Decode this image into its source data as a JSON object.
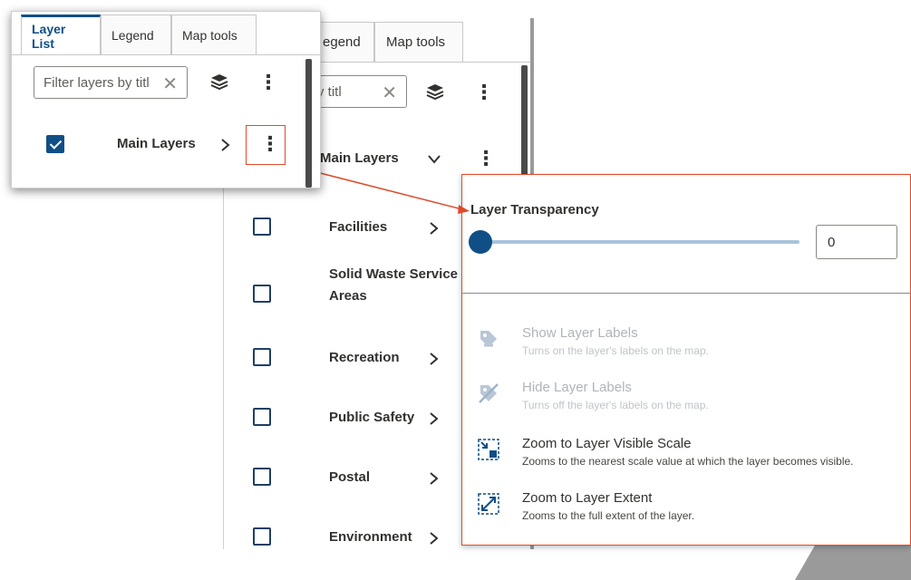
{
  "background_panel": {
    "tabs": [
      {
        "label": "egend"
      },
      {
        "label": "Map tools"
      }
    ],
    "filter_visible_text": "y titl",
    "rows": [
      {
        "label": "Main Layers",
        "checked": false,
        "expand": "chevron-down"
      },
      {
        "label": "Facilities",
        "checked": false,
        "expand": "chevron-right"
      },
      {
        "label_line1": "Solid Waste Service",
        "label_line2": "Areas",
        "checked": false
      },
      {
        "label": "Recreation",
        "checked": false,
        "expand": "chevron-right"
      },
      {
        "label": "Public Safety",
        "checked": false,
        "expand": "chevron-right"
      },
      {
        "label": "Postal",
        "checked": false,
        "expand": "chevron-right"
      },
      {
        "label": "Environment",
        "checked": false,
        "expand": "chevron-right"
      }
    ]
  },
  "popup": {
    "transparency_label": "Layer Transparency",
    "transparency_value": "0",
    "items": [
      {
        "label": "Show Layer Labels",
        "desc": "Turns on the layer's labels on the map.",
        "enabled": false,
        "icon": "tag-icon"
      },
      {
        "label": "Hide Layer Labels",
        "desc": "Turns off the layer's labels on the map.",
        "enabled": false,
        "icon": "tag-off-icon"
      },
      {
        "label": "Zoom to Layer Visible Scale",
        "desc": "Zooms to the nearest scale value at which the layer becomes visible.",
        "enabled": true,
        "icon": "zoom-scale-icon"
      },
      {
        "label": "Zoom to Layer Extent",
        "desc": "Zooms to the full extent of the layer.",
        "enabled": true,
        "icon": "zoom-extent-icon"
      }
    ]
  },
  "inset": {
    "tabs": [
      {
        "label": "Layer List",
        "active": true
      },
      {
        "label": "Legend",
        "active": false
      },
      {
        "label": "Map tools",
        "active": false
      }
    ],
    "filter_placeholder": "Filter layers by titl",
    "row": {
      "label": "Main Layers",
      "checked": true
    }
  },
  "colors": {
    "accent": "#0f4f86",
    "highlight": "#e04a2a"
  }
}
